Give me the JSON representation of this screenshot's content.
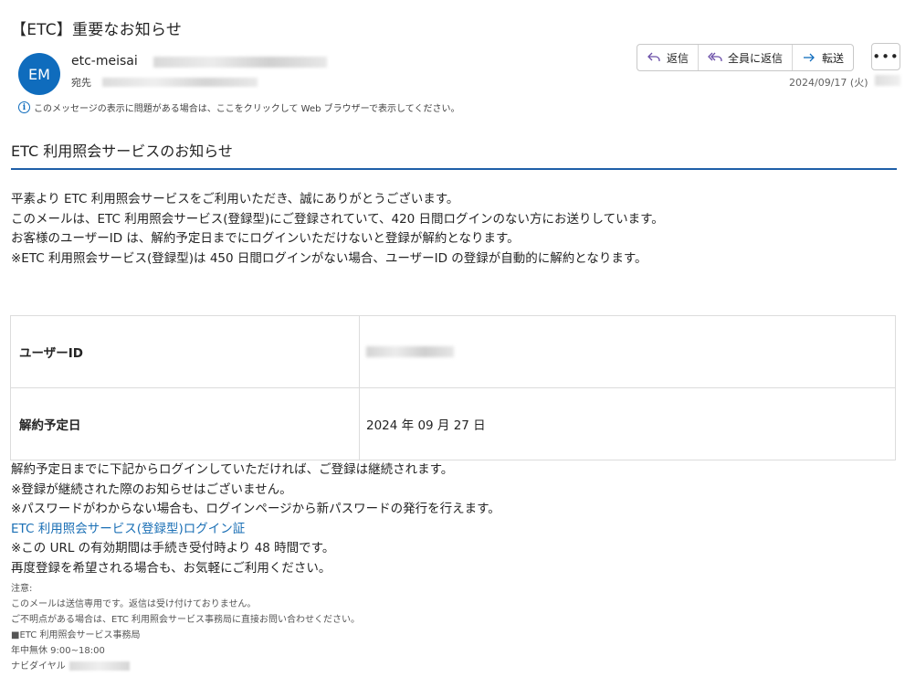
{
  "subject": "【ETC】重要なお知らせ",
  "sender": {
    "initials": "EM",
    "name": "etc-meisai",
    "to_label": "宛先"
  },
  "actions": {
    "reply": "返信",
    "reply_all": "全員に返信",
    "forward": "転送",
    "more": "•••"
  },
  "date": "2024/09/17 (火)",
  "info_bar": "このメッセージの表示に問題がある場合は、ここをクリックして Web ブラウザーで表示してください。",
  "body": {
    "heading": "ETC 利用照会サービスのお知らせ",
    "intro": [
      "平素より ETC 利用照会サービスをご利用いただき、誠にありがとうございます。",
      "このメールは、ETC 利用照会サービス(登録型)にご登録されていて、420 日間ログインのない方にお送りしています。",
      "お客様のユーザーID は、解約予定日までにログインいただけないと登録が解約となります。",
      "※ETC 利用照会サービス(登録型)は 450 日間ログインがない場合、ユーザーID の登録が自動的に解約となります。"
    ],
    "table": {
      "user_id_label": "ユーザーID",
      "cancel_date_label": "解約予定日",
      "cancel_date_value": "2024 年 09 月 27 日"
    },
    "after": [
      "解約予定日までに下記からログインしていただければ、ご登録は継続されます。",
      "※登録が継続された際のお知らせはございません。",
      "※パスワードがわからない場合も、ログインページから新パスワードの発行を行えます。"
    ],
    "link_text": "ETC 利用照会サービス(登録型)ログイン証",
    "after2": [
      "※この URL の有効期間は手続き受付時より 48 時間です。",
      "再度登録を希望される場合も、お気軽にご利用ください。"
    ],
    "notes": [
      "注意:",
      "このメールは送信専用です。返信は受け付けておりません。",
      "ご不明点がある場合は、ETC 利用照会サービス事務局に直接お問い合わせください。",
      "■ETC 利用照会サービス事務局",
      "年中無休 9:00~18:00"
    ],
    "phone_label": "ナビダイヤル"
  },
  "colors": {
    "accent": "#0f6cbd",
    "rule": "#1f5fa8",
    "link": "#1a6fb5"
  }
}
